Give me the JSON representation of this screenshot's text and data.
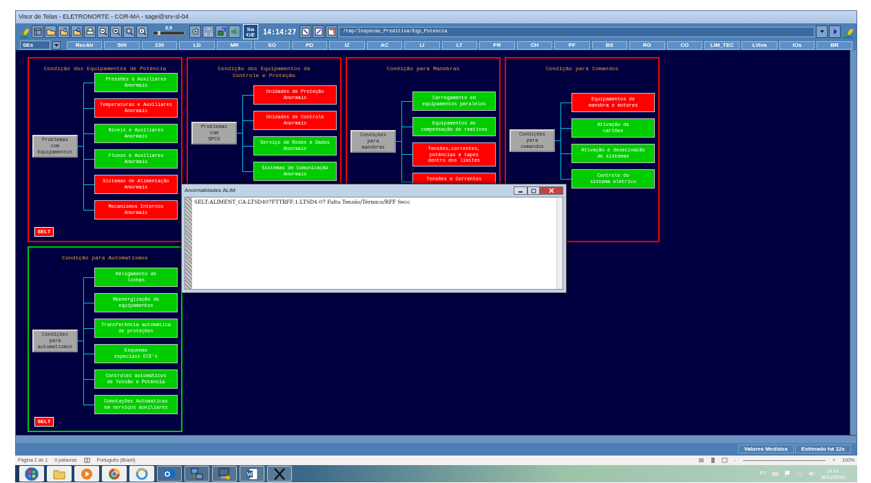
{
  "window": {
    "title": "Visor de Telas - ELETRONORTE - COR-MA  - sage@srv-sl-04"
  },
  "toolbar": {
    "zoom_reading": "0.9",
    "zoom_slider": {
      "level": 0.15
    },
    "logo": "Sa\nGE",
    "time": "14:14:27",
    "path": "/tmp/Inspecao_Preditiva/Eqp_Potencia"
  },
  "nav": {
    "selector": "SEs",
    "buttons": [
      "RecAlr",
      "500",
      "230",
      "LD",
      "MR",
      "SO",
      "PD",
      "IZ",
      "AC",
      "LI",
      "LT",
      "PR",
      "CH",
      "PF",
      "BS",
      "RG",
      "CO",
      "LIM_TEC",
      "LViva",
      "IOs",
      "BR"
    ]
  },
  "panels": [
    {
      "title": "Condição dos Equipamentos de Potência",
      "color": "#ff0000",
      "root": "Problemas\ncom\nEquipamentos",
      "selt": "SELT",
      "items": [
        {
          "label": "Pressões e Auxiliares\nAnormais",
          "color": "#00cc00"
        },
        {
          "label": "Temperaturas e Auxiliares\nAnormais",
          "color": "#ff0000"
        },
        {
          "label": "Níveis e Auxiliares\nAnormais",
          "color": "#00cc00"
        },
        {
          "label": "Fluxos e Auxiliares\nAnormais",
          "color": "#00cc00"
        },
        {
          "label": "Sistemas de Alimentação\nAnormais",
          "color": "#ff0000"
        },
        {
          "label": "Mecanismos Internos\nAnormais",
          "color": "#ff0000"
        }
      ]
    },
    {
      "title": "Condição dos Equipamentos de\nControle e Proteção",
      "color": "#ff0000",
      "root": "Problemas\ncom\nSPCS",
      "items": [
        {
          "label": "Unidades de Proteção\nAnormais",
          "color": "#ff0000"
        },
        {
          "label": "Unidades de Controle\nAnormais",
          "color": "#ff0000"
        },
        {
          "label": "Serviço de Redes e Dados\nAnormais",
          "color": "#00cc00"
        },
        {
          "label": "Sistemas de Comunicação\nAnormais",
          "color": "#00cc00"
        }
      ]
    },
    {
      "title": "Condição para Manobras",
      "color": "#ff0000",
      "root": "Condições\npara\nmanobras",
      "items": [
        {
          "label": "Carregamento em\nequipamentos paralelos",
          "color": "#00cc00"
        },
        {
          "label": "Equipamentos de\ncompensação de reativos",
          "color": "#00cc00"
        },
        {
          "label": "Tensões,correntes,\npotências e tapes\ndentro dos limites",
          "color": "#ff0000"
        },
        {
          "label": "Tensões e Correntes",
          "color": "#ff0000"
        }
      ]
    },
    {
      "title": "Condição para Comandos",
      "color": "#ff0000",
      "root": "Condições\npara\ncomandos",
      "items": [
        {
          "label": "Equipamentos de\nmanobra e motores",
          "color": "#ff0000"
        },
        {
          "label": "Ativação de\ncartões",
          "color": "#00cc00"
        },
        {
          "label": "Ativação e desativação\nde sistemas",
          "color": "#00cc00"
        },
        {
          "label": "Controle do\nsistema elétrico",
          "color": "#00cc00"
        }
      ]
    },
    {
      "title": "Condição para Automatismos",
      "color": "#00cc00",
      "root": "Condições\npara\nautomatismos",
      "selt": "SELT",
      "items": [
        {
          "label": "Religamento de\nlinhas",
          "color": "#00cc00"
        },
        {
          "label": "Reenergização de\nequipamentos",
          "color": "#00cc00"
        },
        {
          "label": "Transferência automática\nde proteções",
          "color": "#00cc00"
        },
        {
          "label": "Esquemas\nespeciais ECE's",
          "color": "#00cc00"
        },
        {
          "label": "Controles automáticos\nde Tensão e Potência",
          "color": "#00cc00"
        },
        {
          "label": "Comutações Automáticas\nem serviços auxiliares",
          "color": "#00cc00"
        }
      ]
    }
  ],
  "popup": {
    "title": "Anormalidades ALIM",
    "text": "SELT:ALIMENT_CA:LTSD407FTTRFF:1:LTSD4-07 Falta Tensão/Térmico/RFF Secc"
  },
  "status_bar": {
    "fields": [
      "Valores Medidos",
      "Estimado há 12s"
    ]
  },
  "word_status": {
    "page": "Página 1 de 1",
    "words": "0 palavras",
    "language": "Português (Brasil)",
    "zoom_minus": "-",
    "zoom_plus": "+",
    "zoom": "100%"
  },
  "taskbar": {
    "language": "PT",
    "time": "14:14",
    "date": "30/12/2016"
  }
}
